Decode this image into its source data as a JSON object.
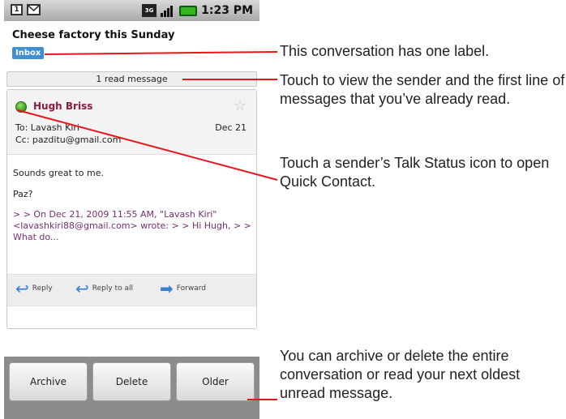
{
  "status_bar": {
    "icons": [
      "calendar-icon",
      "gmail-icon"
    ],
    "calendar_glyph": "1",
    "network_label": "3G",
    "time": "1:23 PM"
  },
  "conversation": {
    "subject": "Cheese factory this Sunday",
    "label": "Inbox",
    "read_summary": "1 read message"
  },
  "message": {
    "sender": "Hugh Briss",
    "to_line": "To: Lavash Kiri",
    "date": "Dec 21",
    "cc_line": "Cc: pazditu@gmail.com",
    "body_lines": [
      "Sounds great to me.",
      "Paz?"
    ],
    "quoted": "> > On Dec 21, 2009 11:55 AM, \"Lavash Kiri\" <lavashkiri88@gmail.com> wrote: > > Hi Hugh, > > What do..."
  },
  "actions": {
    "reply": "Reply",
    "reply_all": "Reply to all",
    "forward": "Forward"
  },
  "bottom_buttons": {
    "archive": "Archive",
    "delete": "Delete",
    "older": "Older"
  },
  "callouts": {
    "label_note": "This conversation has one label.",
    "read_note": "Touch to view the sender and the first line of messages that you’ve already read.",
    "status_note": "Touch a sender’s Talk Status icon to open Quick Contact.",
    "buttons_note": "You can archive or delete the entire conversation or read your next oldest unread message."
  },
  "colors": {
    "callout_line": "#e8151b",
    "label_chip": "#3f8fd1",
    "sender": "#8a1c3f",
    "quote": "#7a2d73"
  }
}
